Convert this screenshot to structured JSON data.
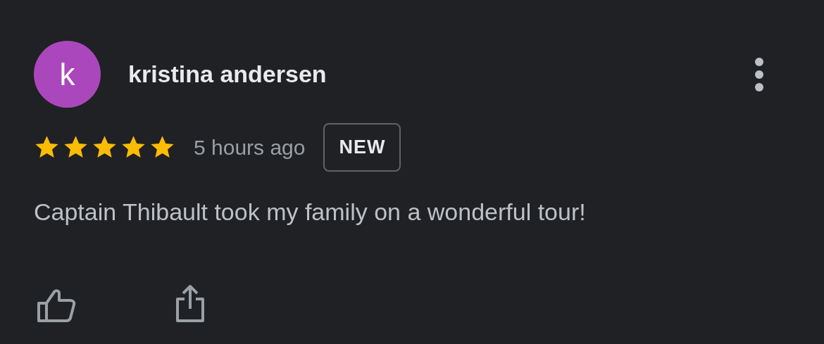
{
  "review": {
    "avatar_initial": "k",
    "author": "kristina andersen",
    "stars": 5,
    "time": "5 hours ago",
    "badge": "NEW",
    "text": "Captain Thibault took my family on a wonderful tour!"
  }
}
